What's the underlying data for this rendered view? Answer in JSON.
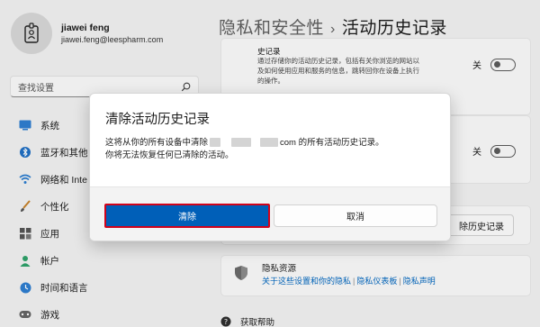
{
  "user": {
    "name": "jiawei feng",
    "email": "jiawei.feng@leespharm.com"
  },
  "search": {
    "placeholder": "查找设置"
  },
  "nav": {
    "items": [
      {
        "label": "系统",
        "icon": "monitor-icon"
      },
      {
        "label": "蓝牙和其他",
        "icon": "bluetooth-icon"
      },
      {
        "label": "网络和 Inte",
        "icon": "wifi-icon"
      },
      {
        "label": "个性化",
        "icon": "brush-icon"
      },
      {
        "label": "应用",
        "icon": "apps-icon"
      },
      {
        "label": "帐户",
        "icon": "person-icon"
      },
      {
        "label": "时间和语言",
        "icon": "globe-clock-icon"
      },
      {
        "label": "游戏",
        "icon": "gamepad-icon"
      }
    ]
  },
  "page": {
    "breadcrumb_parent": "隐私和安全性",
    "breadcrumb_separator": "›",
    "title": "活动历史记录"
  },
  "cards": {
    "store_history": {
      "title": "史记录",
      "description": "通过存储你的活动历史记录，包括有关你浏览的网站以及如何使用应用和服务的信息，跳转回你在设备上执行的操作。",
      "toggle_label": "关",
      "toggle_state": "off"
    },
    "second": {
      "toggle_label": "关",
      "toggle_state": "off"
    },
    "clear_history": {
      "button_label": "除历史记录"
    },
    "privacy_resources": {
      "title": "隐私资源",
      "links": [
        "关于这些设置和你的隐私",
        "隐私仪表板",
        "隐私声明"
      ]
    }
  },
  "help": {
    "label": "获取帮助"
  },
  "dialog": {
    "title": "清除活动历史记录",
    "message_part1": "这将从你的所有设备中清除",
    "message_part2": "com 的所有活动历史记录。",
    "message_line2": "你将无法恢复任何已清除的活动。",
    "primary_button": "清除",
    "secondary_button": "取消"
  },
  "colors": {
    "accent": "#005fb8",
    "highlight_border": "#d0021b",
    "link": "#0067c0"
  }
}
